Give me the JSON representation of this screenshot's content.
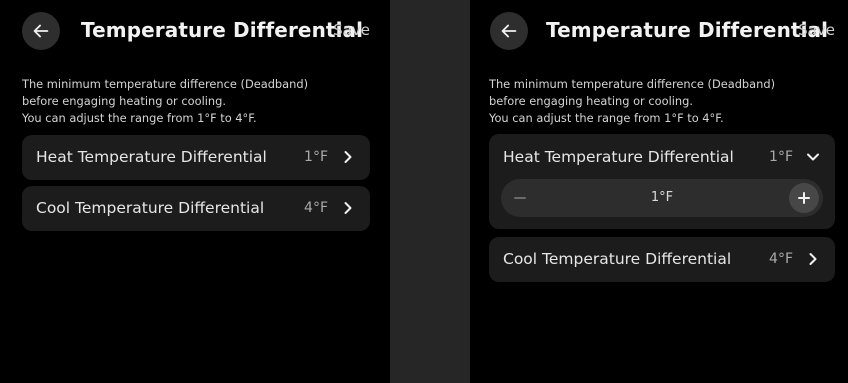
{
  "left": {
    "title": "Temperature Differential",
    "save_label": "Save",
    "description": [
      "The minimum temperature difference (Deadband)",
      "before engaging heating or cooling.",
      "You can adjust the range from 1°F to 4°F."
    ],
    "heat": {
      "label": "Heat Temperature Differential",
      "value": "1°F"
    },
    "cool": {
      "label": "Cool Temperature Differential",
      "value": "4°F"
    }
  },
  "right": {
    "title": "Temperature Differential",
    "save_label": "Save",
    "description": [
      "The minimum temperature difference (Deadband)",
      "before engaging heating or cooling.",
      "You can adjust the range from 1°F to 4°F."
    ],
    "heat": {
      "label": "Heat Temperature Differential",
      "value": "1°F",
      "stepper_value": "1°F"
    },
    "cool": {
      "label": "Cool Temperature Differential",
      "value": "4°F"
    }
  },
  "icons": {
    "back": "arrow-left-icon",
    "chevron_right": "chevron-right-icon",
    "chevron_down": "chevron-down-icon",
    "minus": "minus-icon",
    "plus": "plus-icon"
  },
  "colors": {
    "screen_bg": "#000000",
    "card_bg": "#1c1c1c",
    "divider_bg": "#262626",
    "stepper_bg": "#2d2d2d"
  }
}
